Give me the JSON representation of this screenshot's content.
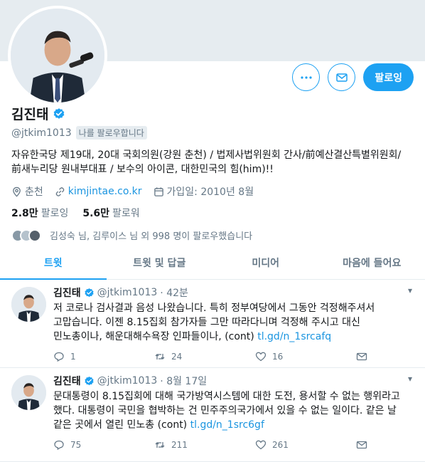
{
  "profile": {
    "name": "김진태",
    "handle": "@jtkim1013",
    "follows_you": "나를 팔로우합니다",
    "bio": "자유한국당 제19대, 20대 국회의원(강원 춘천) / 법제사법위원회 간사/前예산결산특별위원회/ 前새누리당 원내부대표 / 보수의 아이콘, 대한민국의 힘(him)!!",
    "location": "춘천",
    "website": "kimjintae.co.kr",
    "joined": "가입일: 2010년 8월",
    "following_count": "2.8만",
    "following_label": "팔로잉",
    "followers_count": "5.6만",
    "followers_label": "팔로워",
    "known_followers": "김성숙 님, 김루이스 님 외 998 명이 팔로우했습니다"
  },
  "actions": {
    "more_icon": "more-icon",
    "message_icon": "envelope-icon",
    "follow_label": "팔로잉"
  },
  "tabs": [
    {
      "label": "트윗"
    },
    {
      "label": "트윗 및 답글"
    },
    {
      "label": "미디어"
    },
    {
      "label": "마음에 들어요"
    }
  ],
  "tweets": [
    {
      "name": "김진태",
      "handle": "@jtkim1013",
      "time": "· 42분",
      "text": "저 코로나 검사결과 음성 나왔습니다. 특히 정부여당에서 그동안 걱정해주셔서 고맙습니다. 이젠 8.15집회 참가자들 그만 따라다니며 걱정해 주시고 대신 민노총이나, 해운대해수욕장 인파들이나, (cont) ",
      "link": "tl.gd/n_1srcafq",
      "replies": "1",
      "retweets": "24",
      "likes": "16"
    },
    {
      "name": "김진태",
      "handle": "@jtkim1013",
      "time": "· 8월 17일",
      "text": "문대통령이 8.15집회에 대해 국가방역시스템에 대한 도전, 용서할 수 없는 행위라고 했다. 대통령이 국민을 협박하는 건 민주주의국가에서 있을 수 없는 일이다. 같은 날 같은 곳에서 열린 민노총 (cont) ",
      "link": "tl.gd/n_1src6gf",
      "replies": "75",
      "retweets": "211",
      "likes": "261"
    }
  ],
  "colors": {
    "accent": "#1da1f2",
    "banner": "#e6ecf0",
    "muted": "#657786"
  }
}
